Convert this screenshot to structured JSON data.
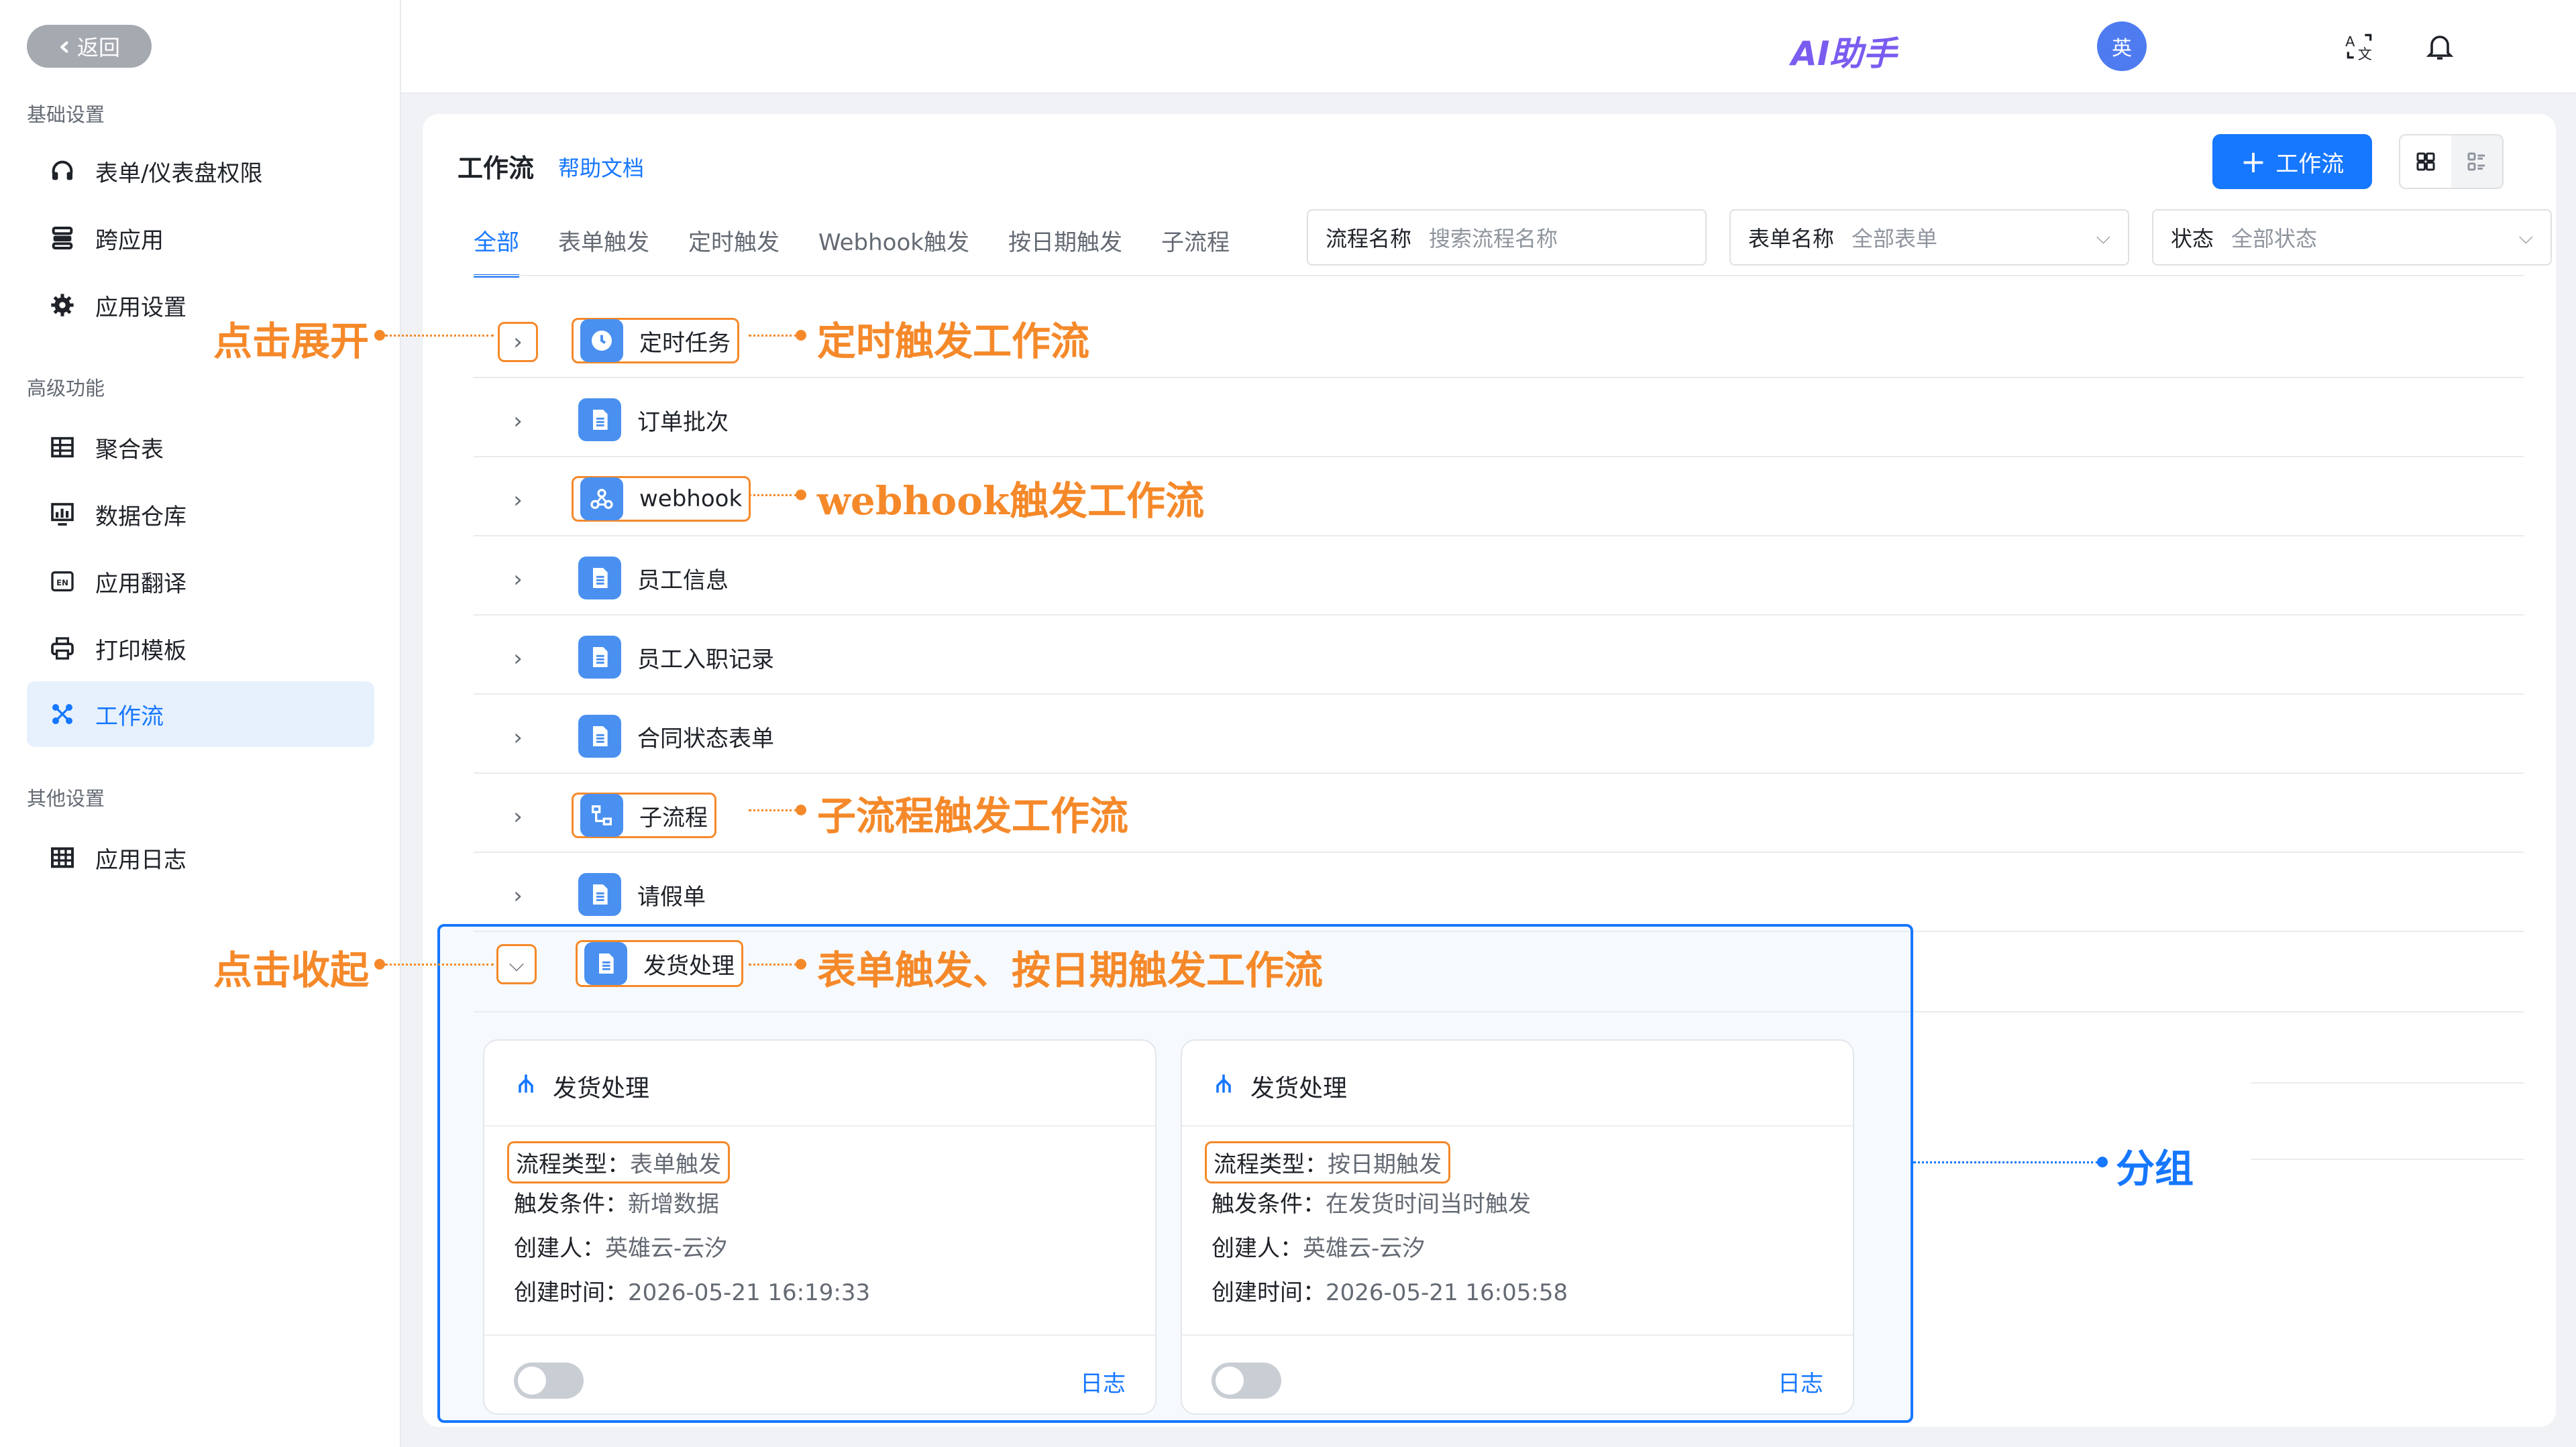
{
  "sidebar": {
    "back_label": "返回",
    "groups": [
      {
        "title": "基础设置",
        "items": [
          {
            "label": "表单/仪表盘权限",
            "icon": "headset-icon"
          },
          {
            "label": "跨应用",
            "icon": "stack-icon"
          },
          {
            "label": "应用设置",
            "icon": "gear-icon"
          }
        ]
      },
      {
        "title": "高级功能",
        "items": [
          {
            "label": "聚合表",
            "icon": "table-icon"
          },
          {
            "label": "数据仓库",
            "icon": "chart-icon"
          },
          {
            "label": "应用翻译",
            "icon": "translate-icon"
          },
          {
            "label": "打印模板",
            "icon": "printer-icon"
          },
          {
            "label": "工作流",
            "icon": "workflow-icon",
            "active": true
          }
        ]
      },
      {
        "title": "其他设置",
        "items": [
          {
            "label": "应用日志",
            "icon": "grid-icon"
          }
        ]
      }
    ]
  },
  "topbar": {
    "ai_label": "AI助手",
    "avatar_text": "英"
  },
  "main": {
    "title": "工作流",
    "help_link": "帮助文档",
    "add_button": "工作流",
    "tabs": [
      "全部",
      "表单触发",
      "定时触发",
      "Webhook触发",
      "按日期触发",
      "子流程"
    ],
    "filters": {
      "name_label": "流程名称",
      "name_placeholder": "搜索流程名称",
      "form_label": "表单名称",
      "form_value": "全部表单",
      "status_label": "状态",
      "status_value": "全部状态"
    },
    "rows": [
      {
        "name": "定时任务",
        "icon": "clock-icon"
      },
      {
        "name": "订单批次",
        "icon": "document-icon"
      },
      {
        "name": "webhook",
        "icon": "webhook-icon"
      },
      {
        "name": "员工信息",
        "icon": "document-icon"
      },
      {
        "name": "员工入职记录",
        "icon": "document-icon"
      },
      {
        "name": "合同状态表单",
        "icon": "document-icon"
      },
      {
        "name": "子流程",
        "icon": "subflow-icon"
      },
      {
        "name": "请假单",
        "icon": "document-icon"
      },
      {
        "name": "发货处理",
        "icon": "document-icon"
      }
    ],
    "cards": [
      {
        "title": "发货处理",
        "type_label": "流程类型：",
        "type_value": "表单触发",
        "trigger_label": "触发条件：",
        "trigger_value": "新增数据",
        "creator_label": "创建人：",
        "creator_value": "英雄云-云汐",
        "created_label": "创建时间：",
        "created_value": "2026-05-21 16:19:33",
        "log_label": "日志",
        "enabled": false
      },
      {
        "title": "发货处理",
        "type_label": "流程类型：",
        "type_value": "按日期触发",
        "trigger_label": "触发条件：",
        "trigger_value": "在发货时间当时触发",
        "creator_label": "创建人：",
        "creator_value": "英雄云-云汐",
        "created_label": "创建时间：",
        "created_value": "2026-05-21 16:05:58",
        "log_label": "日志",
        "enabled": false
      }
    ]
  },
  "annotations": {
    "expand": "点击展开",
    "collapse": "点击收起",
    "timer": "定时触发工作流",
    "webhook": "webhook触发工作流",
    "subflow": "子流程触发工作流",
    "form_date": "表单触发、按日期触发工作流",
    "group": "分组"
  },
  "colors": {
    "accent": "#1677ff",
    "annotation": "#f5892a",
    "active_bg": "#e6f1fd"
  }
}
